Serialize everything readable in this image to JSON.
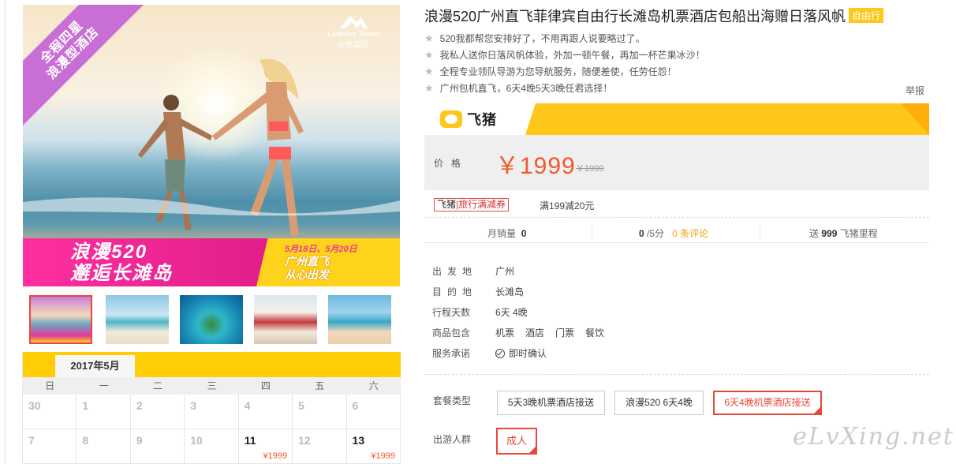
{
  "hero": {
    "ribbon_line1": "全程四星",
    "ribbon_line2": "浪漫型酒店",
    "logo_en": "Lettours Travel",
    "logo_cn": "众信国际",
    "banner_line1": "浪漫520",
    "banner_line2": "邂逅长滩岛",
    "banner_dates": "5月18日、5月20日",
    "banner_depart1": "广州直飞",
    "banner_depart2": "从心出发"
  },
  "thumbnails": [
    {
      "icon": "beach-couple-thumb",
      "active": true
    },
    {
      "icon": "beach-couple-walk-thumb",
      "active": false
    },
    {
      "icon": "island-lagoon-thumb",
      "active": false
    },
    {
      "icon": "beach-wedding-arch-thumb",
      "active": false
    },
    {
      "icon": "beach-friends-thumb",
      "active": false
    }
  ],
  "calendar": {
    "month": "2017年5月",
    "weekdays": [
      "日",
      "一",
      "二",
      "三",
      "四",
      "五",
      "六"
    ],
    "rows": [
      [
        {
          "d": "30"
        },
        {
          "d": "1"
        },
        {
          "d": "2"
        },
        {
          "d": "3"
        },
        {
          "d": "4"
        },
        {
          "d": "5"
        },
        {
          "d": "6"
        }
      ],
      [
        {
          "d": "7"
        },
        {
          "d": "8"
        },
        {
          "d": "9"
        },
        {
          "d": "10"
        },
        {
          "d": "11",
          "price": "¥1999"
        },
        {
          "d": "12"
        },
        {
          "d": "13",
          "price": "¥1999"
        }
      ]
    ]
  },
  "product": {
    "title": "浪漫520广州直飞菲律宾自由行长滩岛机票酒店包船出海赠日落风帆",
    "tag": "自由行",
    "features": [
      "520我都帮您安排好了，不用再跟人说要略过了。",
      "我私人送你日落风帆体验，外加一顿午餐，再加一杯芒果冰沙！",
      "全程专业领队导游为您导航服务，随便差使，任劳任怨！",
      "广州包机直飞，6天4晚5天3晚任君选择！"
    ],
    "report": "举报",
    "brand": "飞猪",
    "price_label": "价格",
    "price_now": "￥1999",
    "price_old": "￥1999",
    "coupon_brand": "飞猪",
    "coupon_text": "旅行满减券",
    "coupon_desc": "满199减20元",
    "stats": {
      "sales_label": "月销量",
      "sales_value": "0",
      "rating_value": "0",
      "rating_suffix": "/5分",
      "reviews_link": "0 条评论",
      "miles_prefix": "送",
      "miles_value": "999",
      "miles_suffix": "飞猪里程"
    },
    "info": [
      {
        "label": "出发地",
        "value": "广州"
      },
      {
        "label": "目的地",
        "value": "长滩岛"
      },
      {
        "label": "行程天数",
        "value": "6天 4晚"
      }
    ],
    "includes_label": "商品包含",
    "includes": [
      "机票",
      "酒店",
      "门票",
      "餐饮"
    ],
    "service_label": "服务承诺",
    "service_value": "即时确认",
    "package_label": "套餐类型",
    "packages": [
      "5天3晚机票酒店接送",
      "浪漫520 6天4晚",
      "6天4晚机票酒店接送"
    ],
    "crowd_label": "出游人群",
    "crowd_option": "成人"
  },
  "watermark": "eLvXing.net"
}
